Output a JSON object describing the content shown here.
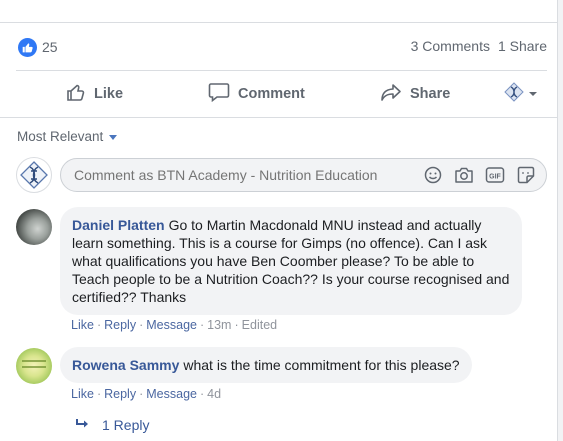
{
  "reactions": {
    "count": "25"
  },
  "counts": {
    "comments": "3 Comments",
    "shares": "1 Share"
  },
  "actions": {
    "like": "Like",
    "comment": "Comment",
    "share": "Share"
  },
  "sort": {
    "label": "Most Relevant"
  },
  "composer": {
    "placeholder": "Comment as BTN Academy - Nutrition Education"
  },
  "comments": [
    {
      "author": "Daniel Platten",
      "text": "Go to Martin Macdonald MNU instead and actually learn something. This is a course for Gimps (no offence). Can I ask what qualifications you have Ben Coomber please? To be able to Teach people to be a Nutrition Coach?? Is your course recognised and certified?? Thanks",
      "like": "Like",
      "reply": "Reply",
      "message": "Message",
      "time": "13m",
      "edited": "Edited"
    },
    {
      "author": "Rowena Sammy",
      "text": "what is the time commitment for this please?",
      "like": "Like",
      "reply": "Reply",
      "message": "Message",
      "time": "4d"
    }
  ],
  "replies": {
    "label": "1 Reply"
  },
  "colors": {
    "accent": "#385898",
    "like_blue": "#2f78f5",
    "muted": "#606770",
    "bubble": "#f2f3f5"
  },
  "icons": [
    "like-thumb-icon",
    "comment-icon",
    "share-arrow-icon",
    "page-avatar-icon",
    "smiley-icon",
    "camera-icon",
    "gif-icon",
    "sticker-icon",
    "reply-arrow-icon"
  ]
}
